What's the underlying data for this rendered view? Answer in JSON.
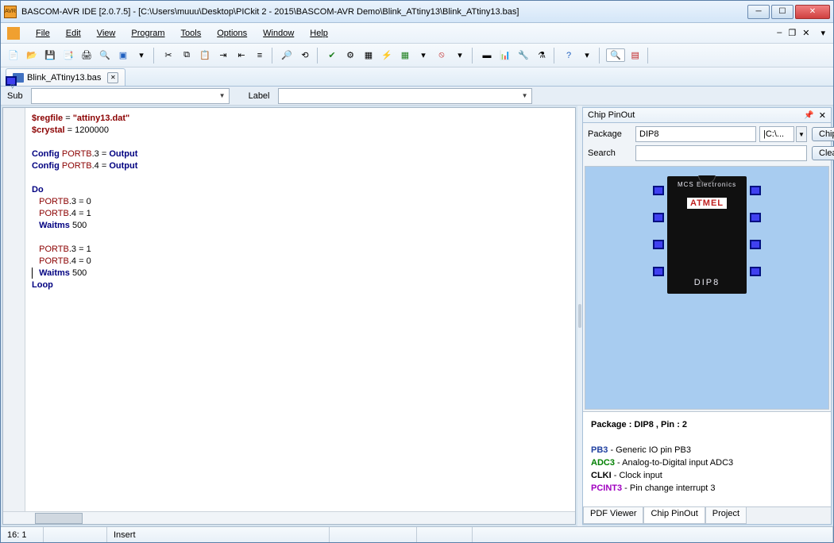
{
  "title": "BASCOM-AVR IDE [2.0.7.5] - [C:\\Users\\muuu\\Desktop\\PICkit 2 - 2015\\BASCOM-AVR Demo\\Blink_ATtiny13\\Blink_ATtiny13.bas]",
  "menu": [
    "File",
    "Edit",
    "View",
    "Program",
    "Tools",
    "Options",
    "Window",
    "Help"
  ],
  "tab": {
    "label": "Blink_ATtiny13.bas"
  },
  "nav": {
    "sub": "Sub",
    "label": "Label"
  },
  "code": {
    "l1a": "$regfile",
    "l1b": " = ",
    "l1c": "\"attiny13.dat\"",
    "l2a": "$crystal",
    "l2b": " = 1200000",
    "l3": "",
    "l4a": "Config ",
    "l4b": "PORTB",
    "l4c": ".3 = ",
    "l4d": "Output",
    "l5a": "Config ",
    "l5b": "PORTB",
    "l5c": ".4 = ",
    "l5d": "Output",
    "l6": "",
    "l7": "Do",
    "l8a": "   PORTB",
    "l8b": ".3 = 0",
    "l9a": "   PORTB",
    "l9b": ".4 = 1",
    "l10a": "   Waitms",
    "l10b": " 500",
    "l11": "",
    "l12a": "   PORTB",
    "l12b": ".3 = 1",
    "l13a": "   PORTB",
    "l13b": ".4 = 0",
    "l14a": "   Waitms",
    "l14b": " 500",
    "l15": "Loop"
  },
  "pinout": {
    "title": "Chip PinOut",
    "packageLabel": "Package",
    "packageValue": "DIP8",
    "pathValue": "|C:\\...",
    "searchLabel": "Search",
    "chipSearchBtn": "Chip Search",
    "clearBtn": "Clear Pin HL",
    "chipBrand": "MCS Electronics",
    "chipLogo": "ATMEL",
    "chipPkg": "DIP8",
    "info": {
      "header": "Package : DIP8 , Pin : 2",
      "pb3": "PB3",
      "pb3t": " - Generic IO pin PB3",
      "adc3": "ADC3",
      "adc3t": " - Analog-to-Digital input ADC3",
      "clki": "CLKI",
      "clki_t": " - Clock input",
      "pcint3": "PCINT3",
      "pcint3t": " - Pin change interrupt 3"
    },
    "tabs": [
      "PDF Viewer",
      "Chip PinOut",
      "Project"
    ]
  },
  "status": {
    "pos": "16: 1",
    "mode": "Insert"
  }
}
